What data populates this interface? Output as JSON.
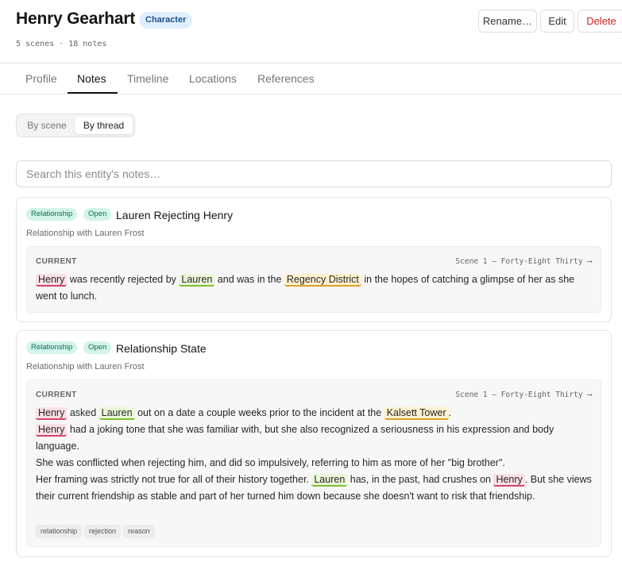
{
  "header": {
    "title": "Henry Gearhart",
    "type_badge": "Character",
    "meta": "5 scenes · 18 notes",
    "rename_label": "Rename…",
    "edit_label": "Edit",
    "delete_label": "Delete"
  },
  "tabs": [
    {
      "label": "Profile",
      "active": false
    },
    {
      "label": "Notes",
      "active": true
    },
    {
      "label": "Timeline",
      "active": false
    },
    {
      "label": "Locations",
      "active": false
    },
    {
      "label": "References",
      "active": false
    }
  ],
  "view_toggle": {
    "by_scene": "By scene",
    "by_thread": "By thread",
    "selected": "By thread"
  },
  "search": {
    "placeholder": "Search this entity's notes…",
    "value": ""
  },
  "threads": [
    {
      "category": "Relationship",
      "status": "Open",
      "title": "Lauren Rejecting Henry",
      "subtitle": "Relationship with Lauren Frost",
      "current_label": "CURRENT",
      "scene_ref": "Scene 1 — Forty-Eight Thirty ⟶",
      "paragraphs": [
        {
          "m1": "Henry",
          "t1": " was recently rejected by ",
          "m2": "Lauren",
          "t2": " and was in the ",
          "m3": "Regency District",
          "t3": " in the hopes of catching a glimpse of her as she went to lunch."
        }
      ],
      "tags": []
    },
    {
      "category": "Relationship",
      "status": "Open",
      "title": "Relationship State",
      "subtitle": "Relationship with Lauren Frost",
      "current_label": "CURRENT",
      "scene_ref": "Scene 1 — Forty-Eight Thirty ⟶",
      "paragraphs": [
        {
          "m1": "Henry",
          "t1": " asked ",
          "m2": "Lauren",
          "t2": " out on a date a couple weeks prior to the incident at the ",
          "m3": "Kalsett Tower",
          "t3": "."
        },
        {
          "m1": "Henry",
          "t1": " had a joking tone that she was familiar with, but she also recognized a seriousness in his expression and body language."
        },
        {
          "t1": "She was conflicted when rejecting him, and did so impulsively, referring to him as more of her \"big brother\"."
        },
        {
          "t1": "Her framing was strictly not true for all of their history together. ",
          "m2": "Lauren",
          "t2": " has, in the past, had crushes on ",
          "m3": "Henry",
          "t3": ". But she views their current friendship as stable and part of her turned him down because she doesn't want to risk that friendship."
        }
      ],
      "tags": [
        "relationship",
        "rejection",
        "reason"
      ]
    }
  ],
  "colors": {
    "accent_delete": "#d32222",
    "badge_bg": "#e0efff",
    "pill_bg": "#d3f4ea",
    "mention_character_henry": "#d6456a",
    "mention_character_lauren": "#7bc034",
    "mention_location": "#dba129"
  }
}
